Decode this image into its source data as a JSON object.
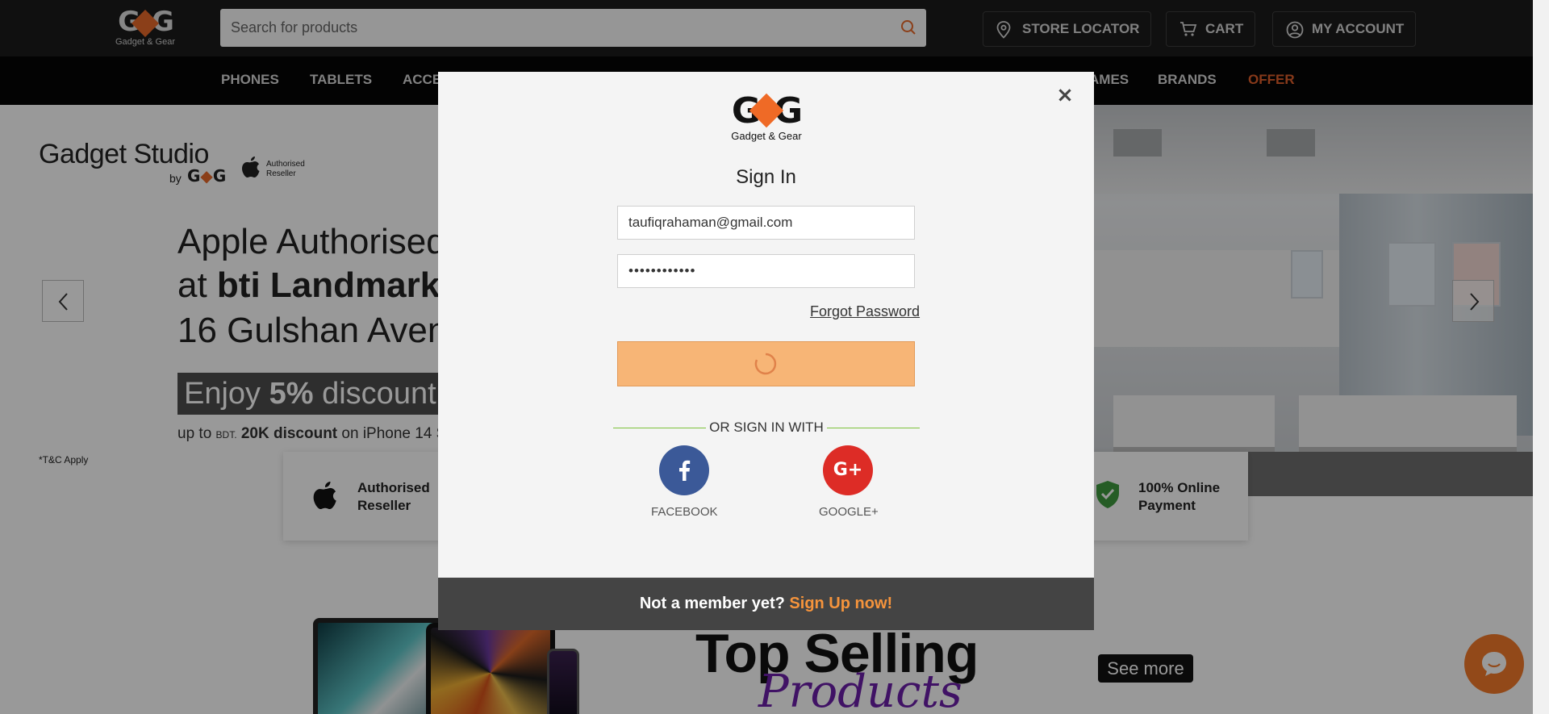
{
  "header": {
    "logo_text": "Gadget & Gear",
    "search_placeholder": "Search for products",
    "store_locator": "STORE LOCATOR",
    "cart": "CART",
    "my_account": "MY ACCOUNT"
  },
  "nav": {
    "items": [
      "PHONES",
      "TABLETS",
      "ACCE",
      "AMES",
      "BRANDS",
      "OFFER"
    ]
  },
  "hero": {
    "brand_title": "Gadget Studio",
    "brand_by": "by",
    "brand_badge_line1": "Authorised",
    "brand_badge_line2": "Reseller",
    "line1": "Apple Authorised",
    "line2_prefix": "at ",
    "line2_bold": "bti Landmark",
    "line3": "16 Gulshan Avenu",
    "band_prefix": "Enjoy ",
    "band_bold": "5%",
    "band_suffix": " discount o",
    "sub_prefix": "up to ",
    "sub_small": "BDT.",
    "sub_bold": " 20K discount",
    "sub_suffix": " on iPhone 14 S",
    "tc": "*T&C Apply"
  },
  "features": {
    "left_line1": "Authorised",
    "left_line2": "Reseller",
    "right_line1": "100% Online",
    "right_line2": "Payment"
  },
  "promo": {
    "heading": "Top Selling",
    "script": "Products",
    "see_more": "See more"
  },
  "modal": {
    "logo_sub": "Gadget & Gear",
    "title": "Sign In",
    "email_value": "taufiqrahaman@gmail.com",
    "password_value": "••••••••••••",
    "forgot": "Forgot Password",
    "divider": "OR SIGN IN WITH",
    "facebook_label": "FACEBOOK",
    "google_label": "GOOGLE+",
    "footer_prefix": "Not a member yet? ",
    "footer_link": "Sign Up now!",
    "close": "×"
  },
  "colors": {
    "accent_orange": "#f47b2b",
    "offer_red": "#e2602c",
    "facebook": "#3b5998",
    "google": "#dd2c26",
    "divider_green": "#7dc23a",
    "submit_loading": "#f7b576"
  },
  "icons": {
    "search": "search-icon",
    "location": "location-pin-icon",
    "cart": "cart-icon",
    "account": "user-circle-icon",
    "chat": "chat-bubble-icon"
  }
}
